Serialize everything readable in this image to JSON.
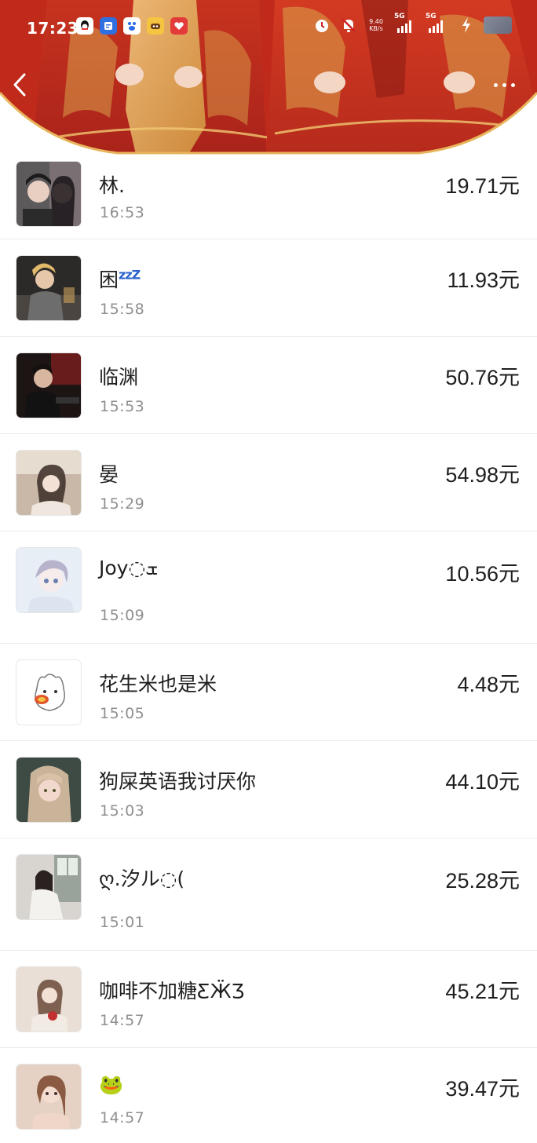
{
  "status_bar": {
    "time": "17:23",
    "net_speed_value": "9.40",
    "net_speed_unit": "KB/s",
    "signal_1_label": "5G",
    "signal_2_label": "5G",
    "app_icons": [
      "qq-icon",
      "docs-icon",
      "baidu-icon",
      "games-icon",
      "health-app-icon"
    ],
    "system_icons": [
      "alarm-icon",
      "mute-icon",
      "bolt-icon"
    ]
  },
  "header": {
    "back_icon": "chevron-left-icon",
    "more_icon": "more-dots-icon"
  },
  "colors": {
    "banner_red": "#c52a1c",
    "banner_gold": "#e7b55c",
    "text_primary": "#1f1f1f",
    "text_secondary": "#8f8f8f",
    "divider": "#ececec"
  },
  "records": [
    {
      "name": "林.",
      "time": "16:53",
      "amount": "19.71元"
    },
    {
      "name": "困",
      "name_suffix": "zzZ",
      "time": "15:58",
      "amount": "11.93元"
    },
    {
      "name": "临渊",
      "time": "15:53",
      "amount": "50.76元"
    },
    {
      "name": "晏",
      "time": "15:29",
      "amount": "54.98元"
    },
    {
      "name": "Joy◌ܫ",
      "time": "15:09",
      "amount": "10.56元"
    },
    {
      "name": "花生米也是米",
      "time": "15:05",
      "amount": "4.48元"
    },
    {
      "name": "狗屎英语我讨厌你",
      "time": "15:03",
      "amount": "44.10元"
    },
    {
      "name": "ღ.汐ル◌(",
      "time": "15:01",
      "amount": "25.28元"
    },
    {
      "name": "咖啡不加糖ƸӜƷ",
      "time": "14:57",
      "amount": "45.21元"
    },
    {
      "name": "🐸",
      "time": "14:57",
      "amount": "39.47元"
    }
  ]
}
